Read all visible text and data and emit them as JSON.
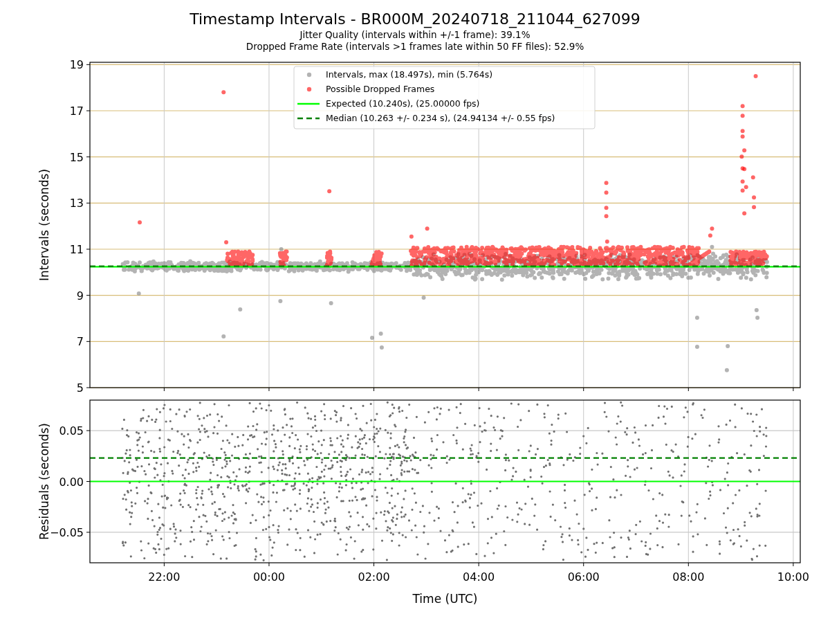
{
  "figure": {
    "title": "Timestamp Intervals - BR000M_20240718_211044_627099",
    "subtitles": [
      "Jitter Quality (intervals within +/-1 frame): 39.1%",
      "Dropped Frame Rate (intervals >1 frames late within 50 FF files): 52.9%"
    ]
  },
  "intervals_plot": {
    "chart_data": {
      "type": "scatter",
      "ylabel": "Intervals (seconds)",
      "xlim": [
        "2024-07-18T20:35",
        "2024-07-19T10:08"
      ],
      "ylim": [
        5,
        19.1
      ],
      "grid": true,
      "yticks": [
        {
          "value": 5,
          "label": "5"
        },
        {
          "value": 7,
          "label": "7"
        },
        {
          "value": 9,
          "label": "9"
        },
        {
          "value": 11,
          "label": "11"
        },
        {
          "value": 13,
          "label": "13"
        },
        {
          "value": 15,
          "label": "15"
        },
        {
          "value": 17,
          "label": "17"
        },
        {
          "value": 19,
          "label": "19"
        }
      ],
      "series": [
        {
          "name": "Intervals, max (18.497s), min (5.764s)",
          "color": "#808080",
          "x": [
            "2024-07-18T23:08",
            "2024-07-19T01:58",
            "2024-07-19T02:08",
            "2024-07-19T02:09",
            "2024-07-19T08:10",
            "2024-07-19T08:44",
            "2024-07-19T08:45",
            "2024-07-19T09:19",
            "2024-07-19T09:18",
            "2024-07-19T08:10",
            "2024-07-18T21:31",
            "2024-07-19T00:13",
            "2024-07-19T01:11",
            "2024-07-18T23:27",
            "2024-07-19T02:57",
            "2024-07-19T00:14",
            "2024-07-19T08:27"
          ],
          "values": [
            7.22,
            7.16,
            7.34,
            6.74,
            6.77,
            5.76,
            6.8,
            8.03,
            8.36,
            8.03,
            9.08,
            8.75,
            8.66,
            8.39,
            8.9,
            11.0,
            11.1
          ]
        },
        {
          "name": "Possible Dropped Frames",
          "color": "#ff0000",
          "x": [
            "2024-07-18T21:32",
            "2024-07-18T23:08",
            "2024-07-19T01:09",
            "2024-07-19T09:17",
            "2024-07-19T09:02",
            "2024-07-19T09:02",
            "2024-07-19T09:02",
            "2024-07-19T09:02",
            "2024-07-19T09:04",
            "2024-07-19T09:01",
            "2024-07-19T09:02",
            "2024-07-19T09:04",
            "2024-07-19T09:14",
            "2024-07-19T09:02",
            "2024-07-19T09:06",
            "2024-07-19T09:02",
            "2024-07-19T09:15",
            "2024-07-19T09:15",
            "2024-07-19T09:04",
            "2024-07-19T06:26",
            "2024-07-19T06:26",
            "2024-07-19T06:26",
            "2024-07-19T06:26",
            "2024-07-19T08:27",
            "2024-07-19T03:01",
            "2024-07-19T08:25",
            "2024-07-19T02:43",
            "2024-07-18T23:11",
            "2024-07-19T06:27"
          ],
          "values": [
            12.16,
            17.8,
            13.51,
            18.5,
            17.2,
            16.78,
            16.12,
            15.88,
            15.28,
            15.01,
            14.5,
            14.47,
            14.11,
            13.93,
            13.69,
            13.54,
            13.24,
            12.82,
            12.55,
            13.87,
            13.45,
            12.79,
            12.43,
            11.89,
            11.89,
            11.59,
            11.55,
            11.3,
            11.33
          ]
        }
      ],
      "ref_lines": [
        {
          "axis": "y",
          "value": 10.24,
          "label": "Expected (10.240s), (25.00000 fps)",
          "color": "#00ff00"
        },
        {
          "axis": "y",
          "value": 10.263,
          "label": "Median (10.263 +/- 0.234 s), (24.94134 +/- 0.55 fps)",
          "color": "#008000"
        }
      ],
      "legend": "upper center"
    }
  },
  "residuals_plot": {
    "chart_data": {
      "type": "scatter",
      "xlabel": "Time (UTC)",
      "ylabel": "Residuals (seconds)",
      "xlim": [
        "2024-07-18T20:35",
        "2024-07-19T10:08"
      ],
      "ylim": [
        -0.08,
        0.08
      ],
      "grid": true,
      "xticks": [
        {
          "value": "2024-07-18T22:00",
          "label": "22:00"
        },
        {
          "value": "2024-07-19T00:00",
          "label": "00:00"
        },
        {
          "value": "2024-07-19T02:00",
          "label": "02:00"
        },
        {
          "value": "2024-07-19T04:00",
          "label": "04:00"
        },
        {
          "value": "2024-07-19T06:00",
          "label": "06:00"
        },
        {
          "value": "2024-07-19T08:00",
          "label": "08:00"
        },
        {
          "value": "2024-07-19T10:00",
          "label": "10:00"
        }
      ],
      "yticks": [
        {
          "value": -0.05,
          "label": "−0.05"
        },
        {
          "value": 0,
          "label": "0.00"
        },
        {
          "value": 0.05,
          "label": "0.05"
        }
      ],
      "ref_lines": [
        {
          "axis": "y",
          "value": 0,
          "color": "#00ff00"
        },
        {
          "axis": "y",
          "value": 0.023,
          "color": "#008000"
        }
      ]
    }
  }
}
